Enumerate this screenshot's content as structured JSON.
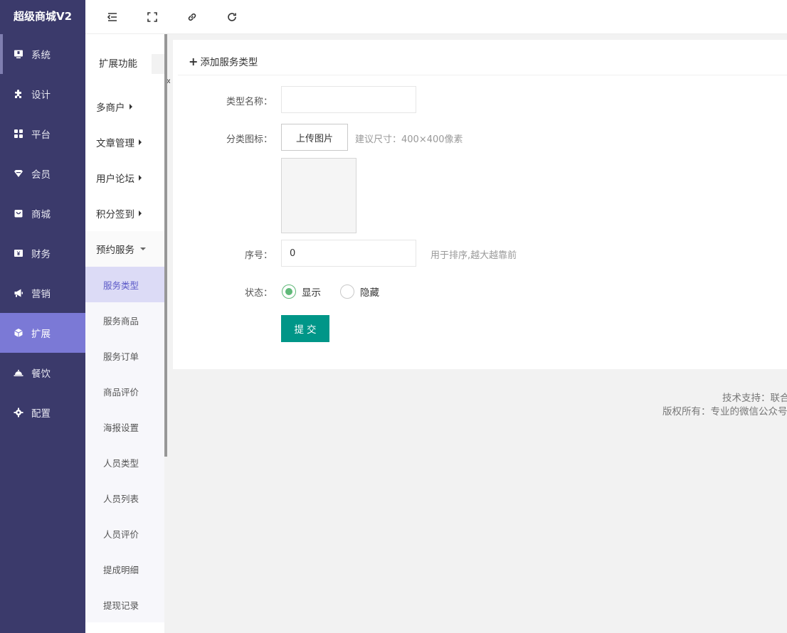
{
  "app": {
    "logo": "超级商城V2"
  },
  "main_nav": [
    {
      "label": "系统",
      "icon": "monitor-icon"
    },
    {
      "label": "设计",
      "icon": "puzzle-icon"
    },
    {
      "label": "平台",
      "icon": "grid-icon"
    },
    {
      "label": "会员",
      "icon": "member-icon"
    },
    {
      "label": "商城",
      "icon": "shopping-bag-icon"
    },
    {
      "label": "财务",
      "icon": "yen-icon"
    },
    {
      "label": "营销",
      "icon": "megaphone-icon"
    },
    {
      "label": "扩展",
      "icon": "cube-icon"
    },
    {
      "label": "餐饮",
      "icon": "cloche-icon"
    },
    {
      "label": "配置",
      "icon": "gear-icon"
    }
  ],
  "toolbar": [
    {
      "icon": "indent-icon"
    },
    {
      "icon": "fullscreen-icon"
    },
    {
      "icon": "link-icon"
    },
    {
      "icon": "refresh-icon"
    }
  ],
  "sub_nav": {
    "title": "扩展功能",
    "collapse_glyph": "«",
    "groups": [
      {
        "label": "多商户"
      },
      {
        "label": "文章管理"
      },
      {
        "label": "用户论坛"
      },
      {
        "label": "积分签到"
      },
      {
        "label": "预约服务"
      }
    ],
    "children": [
      {
        "label": "服务类型"
      },
      {
        "label": "服务商品"
      },
      {
        "label": "服务订单"
      },
      {
        "label": "商品评价"
      },
      {
        "label": "海报设置"
      },
      {
        "label": "人员类型"
      },
      {
        "label": "人员列表"
      },
      {
        "label": "人员评价"
      },
      {
        "label": "提成明细"
      },
      {
        "label": "提现记录"
      }
    ]
  },
  "form": {
    "title": "添加服务类型",
    "name_label": "类型名称：",
    "name_value": "",
    "icon_label": "分类图标：",
    "upload_label": "上传图片",
    "upload_hint": "建议尺寸：400×400像素",
    "sort_label": "序号：",
    "sort_value": "0",
    "sort_hint": "用于排序,越大越靠前",
    "status_label": "状态：",
    "status_options": [
      {
        "label": "显示",
        "checked": true
      },
      {
        "label": "隐藏",
        "checked": false
      }
    ],
    "submit_label": "提交"
  },
  "footer": {
    "line1": "技术支持：联合",
    "line2": "版权所有：专业的微信公众号"
  },
  "colors": {
    "sidebar_bg": "#3b3a6b",
    "sidebar_active": "#7b79d6",
    "sub_active_bg": "#dcdbf6",
    "sub_active_text": "#5b59c7",
    "submit_bg": "#009688",
    "radio_checked": "#5fb878"
  }
}
